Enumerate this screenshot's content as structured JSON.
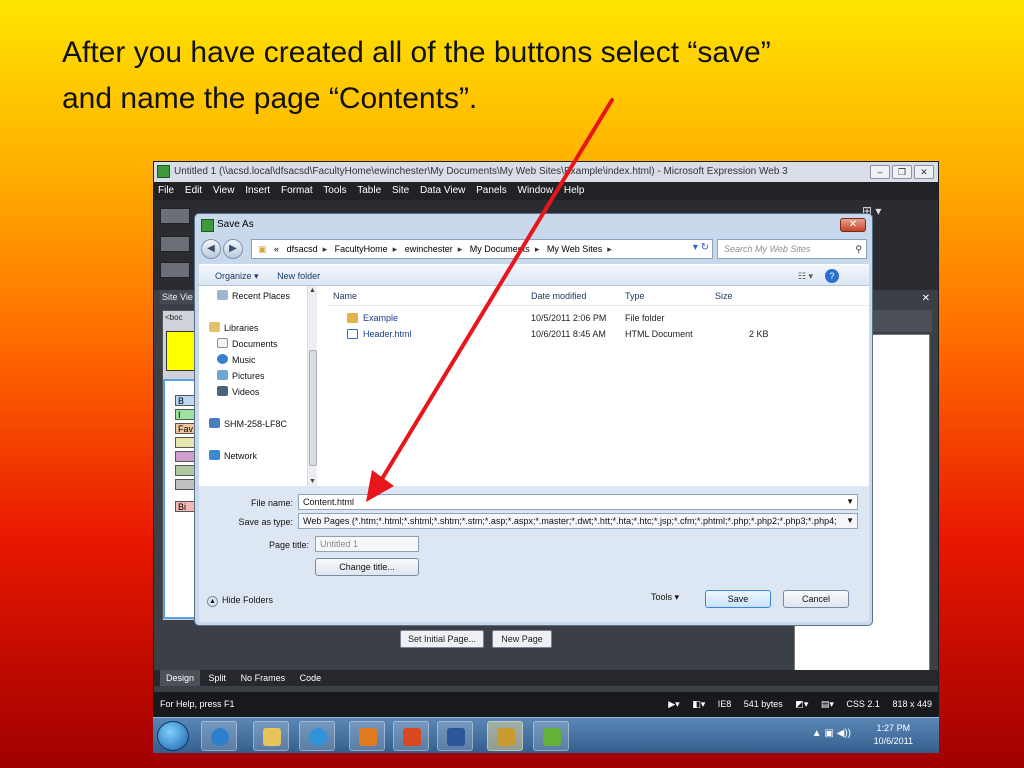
{
  "slide": {
    "title_line1": "After you have created all of the buttons select “save”",
    "title_line2": "and name the page “Contents”."
  },
  "app": {
    "title": "Untitled 1 (\\\\acsd.local\\dfsacsd\\FacultyHome\\ewinchester\\My Documents\\My Web Sites\\Example\\index.html) - Microsoft Expression Web 3",
    "menu": [
      "File",
      "Edit",
      "View",
      "Insert",
      "Format",
      "Tools",
      "Table",
      "Site",
      "Data View",
      "Panels",
      "Window",
      "Help"
    ],
    "site_view_tab": "Site Vie",
    "body_tag": "<boc",
    "nav_buttons": [
      "B",
      "I",
      "Fav",
      "Bi"
    ],
    "set_initial_page_label": "Set Initial Page...",
    "new_page_label": "New Page",
    "view_tabs": [
      "Design",
      "Split",
      "No Frames",
      "Code"
    ],
    "status": {
      "help": "For Help, press F1",
      "ie": "IE8",
      "size": "541 bytes",
      "css": "CSS 2.1",
      "dims": "818 x 449"
    }
  },
  "taskbar": {
    "time": "1:27 PM",
    "date": "10/6/2011"
  },
  "dialog": {
    "title": "Save As",
    "breadcrumb": [
      "«",
      "dfsacsd",
      "FacultyHome",
      "ewinchester",
      "My Documents",
      "My Web Sites"
    ],
    "search_placeholder": "Search My Web Sites",
    "organize_label": "Organize ▾",
    "new_folder_label": "New folder",
    "nav_items": [
      {
        "label": "Recent Places"
      },
      {
        "label": "Libraries"
      },
      {
        "label": "Documents"
      },
      {
        "label": "Music"
      },
      {
        "label": "Pictures"
      },
      {
        "label": "Videos"
      },
      {
        "label": "SHM-258-LF8C"
      },
      {
        "label": "Network"
      }
    ],
    "columns": {
      "name": "Name",
      "date": "Date modified",
      "type": "Type",
      "size": "Size"
    },
    "files": [
      {
        "name": "Example",
        "date": "10/5/2011 2:06 PM",
        "type": "File folder",
        "size": ""
      },
      {
        "name": "Header.html",
        "date": "10/6/2011 8:45 AM",
        "type": "HTML Document",
        "size": "2 KB"
      }
    ],
    "file_name_label": "File name:",
    "file_name_value": "Content.html",
    "save_type_label": "Save as type:",
    "save_type_value": "Web Pages (*.htm;*.html;*.shtml;*.shtm;*.stm;*.asp;*.aspx;*.master;*.dwt;*.htt;*.hta;*.htc;*.jsp;*.cfm;*.phtml;*.php;*.php2;*.php3;*.php4;",
    "page_title_label": "Page title:",
    "page_title_value": "Untitled 1",
    "change_title_label": "Change title...",
    "hide_folders_label": "Hide Folders",
    "tools_label": "Tools",
    "save_label": "Save",
    "cancel_label": "Cancel"
  },
  "colors": {
    "annotation_arrow": "#e8161b",
    "dialog_frame": "#c9d9ec"
  }
}
